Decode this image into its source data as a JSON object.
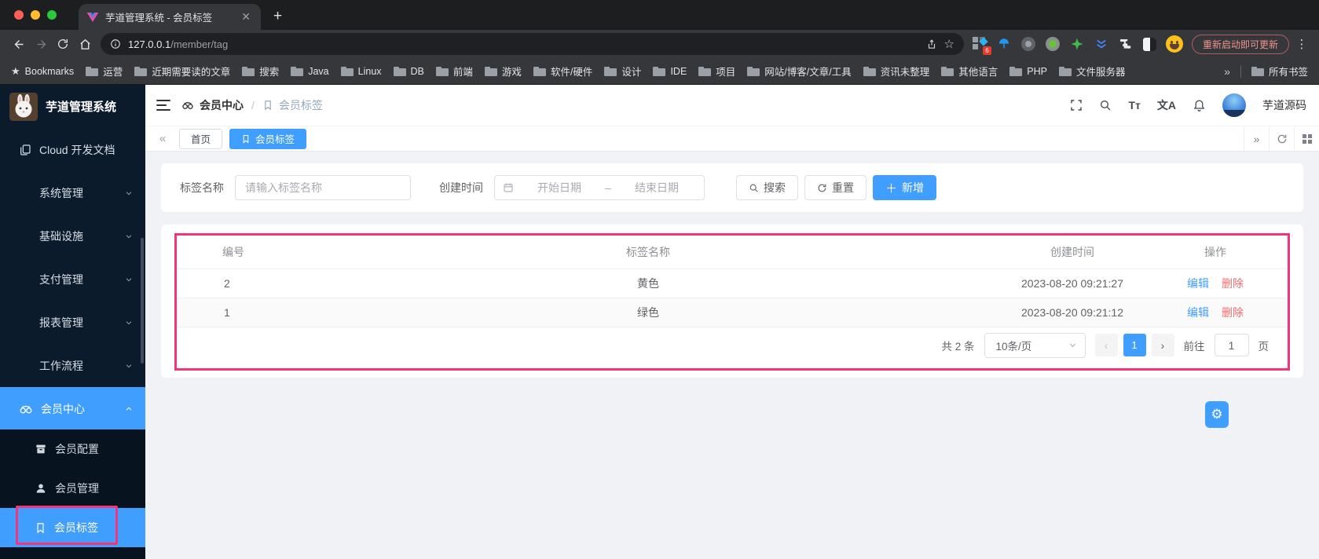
{
  "browser": {
    "tab_title": "芋道管理系统 - 会员标签",
    "url_host": "127.0.0.1",
    "url_path": "/member/tag",
    "update_button": "重新启动即可更新",
    "extension_badge": "6",
    "bookmarks_label": "Bookmarks",
    "bookmark_folders": [
      "运营",
      "近期需要读的文章",
      "搜索",
      "Java",
      "Linux",
      "DB",
      "前端",
      "游戏",
      "软件/硬件",
      "设计",
      "IDE",
      "项目",
      "网站/博客/文章/工具",
      "资讯未整理",
      "其他语言",
      "PHP",
      "文件服务器"
    ],
    "bookmarks_overflow": "»",
    "all_bookmarks_label": "所有书签"
  },
  "sidebar": {
    "app_title": "芋道管理系统",
    "doc_link": "Cloud 开发文档",
    "groups": [
      "系统管理",
      "基础设施",
      "支付管理",
      "报表管理",
      "工作流程"
    ],
    "member_center": "会员中心",
    "submenu": [
      "会员配置",
      "会员管理",
      "会员标签"
    ]
  },
  "navbar": {
    "breadcrumb_parent": "会员中心",
    "breadcrumb_separator": "/",
    "breadcrumb_current": "会员标签",
    "font_size_icon_text": "Tт",
    "locale_icon_text": "文A",
    "username": "芋道源码"
  },
  "tagsbar": {
    "back": "«",
    "forward": "»",
    "home_tab": "首页",
    "active_tab": "会员标签"
  },
  "filter": {
    "tag_name_label": "标签名称",
    "tag_name_placeholder": "请输入标签名称",
    "create_time_label": "创建时间",
    "start_date_placeholder": "开始日期",
    "range_separator": "–",
    "end_date_placeholder": "结束日期",
    "search_button": "搜索",
    "reset_button": "重置",
    "add_button": "新增"
  },
  "table": {
    "columns": [
      "编号",
      "标签名称",
      "创建时间",
      "操作"
    ],
    "rows": [
      {
        "id": "2",
        "name": "黄色",
        "created": "2023-08-20 09:21:27"
      },
      {
        "id": "1",
        "name": "绿色",
        "created": "2023-08-20 09:21:12"
      }
    ],
    "edit_label": "编辑",
    "delete_label": "删除"
  },
  "pagination": {
    "total": "共 2 条",
    "page_size": "10条/页",
    "prev": "‹",
    "page": "1",
    "next": "›",
    "goto_label": "前往",
    "goto_value": "1",
    "unit_label": "页"
  },
  "colors": {
    "primary": "#409eff",
    "danger": "#f56c6c",
    "annotation": "#f1357b",
    "sidebar_bg": "#0c1b2c",
    "submenu_bg": "#081320"
  }
}
